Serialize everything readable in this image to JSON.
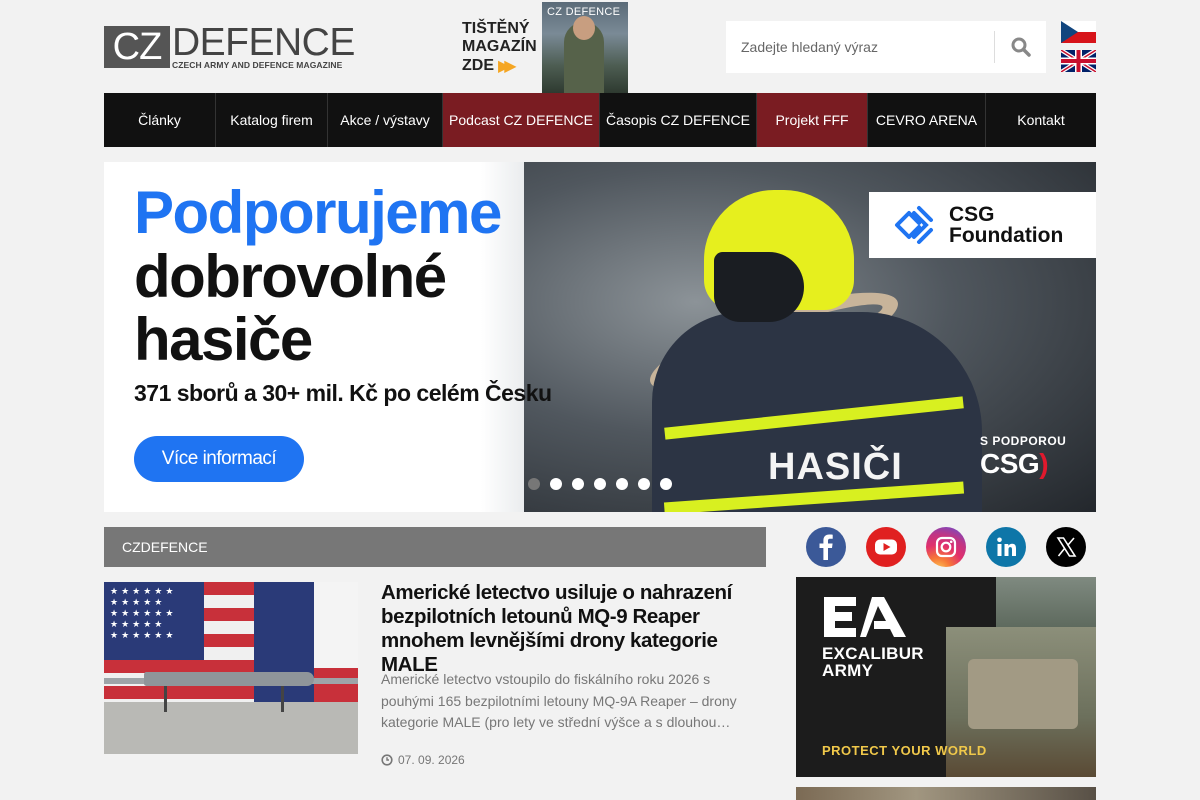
{
  "header": {
    "logo_cz": "CZ",
    "logo_defence": "DEFENCE",
    "logo_subtitle": "CZECH ARMY AND DEFENCE MAGAZINE",
    "magazine_promo": {
      "line1": "TIŠTĚNÝ",
      "line2": "MAGAZÍN",
      "line3": "ZDE",
      "arrows": "▶▶",
      "cover_title": "CZ DEFENCE"
    },
    "search": {
      "placeholder": "Zadejte hledaný výraz",
      "value": ""
    },
    "languages": [
      "cs",
      "en"
    ]
  },
  "nav": {
    "items": [
      {
        "label": "Články",
        "highlight": false
      },
      {
        "label": "Katalog firem",
        "highlight": false
      },
      {
        "label": "Akce / výstavy",
        "highlight": false
      },
      {
        "label": "Podcast CZ DEFENCE",
        "highlight": true
      },
      {
        "label": "Časopis CZ DEFENCE",
        "highlight": false
      },
      {
        "label": "Projekt FFF",
        "highlight": true
      },
      {
        "label": "CEVRO ARENA",
        "highlight": false
      },
      {
        "label": "Kontakt",
        "highlight": false
      }
    ]
  },
  "hero": {
    "headline_blue": "Podporujeme",
    "headline_line2": "dobrovolné",
    "headline_line3": "hasiče",
    "subline": "371 sborů a 30+ mil. Kč po celém Česku",
    "cta": "Více informací",
    "badge_line1": "CSG",
    "badge_line2": "Foundation",
    "uniform_text": "HASIČI",
    "support_small": "S PODPOROU",
    "support_brand": "CSG",
    "slides_count": 7,
    "active_slide": 1,
    "colors": {
      "accent_blue": "#1f74f2",
      "helmet": "#e6ef1e",
      "csg_red": "#e0192d"
    }
  },
  "section": {
    "title": "CZDEFENCE"
  },
  "article": {
    "title": "Americké letectvo usiluje o nahrazení bezpilotních letounů MQ-9 Reaper mnohem levnějšími drony kategorie MALE",
    "excerpt": "Americké letectvo vstoupilo do fiskálního roku 2026 s pouhými 165 bezpilotními letouny MQ-9A Reaper – drony kategorie MALE (pro lety ve střední výšce a s dlouhou…",
    "date": "07. 09. 2026"
  },
  "social": [
    "facebook-icon",
    "youtube-icon",
    "instagram-icon",
    "linkedin-icon",
    "x-icon"
  ],
  "ad": {
    "logo": "EA",
    "name_line1": "EXCALIBUR",
    "name_line2": "ARMY",
    "tagline": "PROTECT YOUR WORLD"
  }
}
